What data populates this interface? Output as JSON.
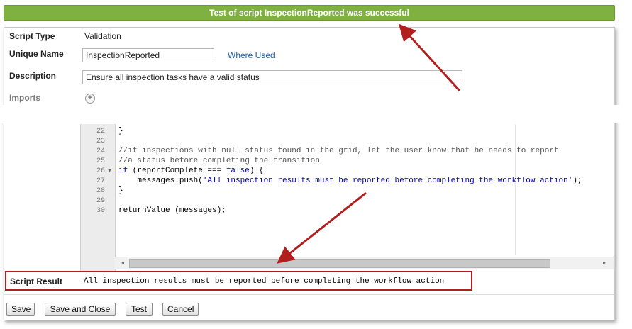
{
  "banner": {
    "message": "Test of script InspectionReported was successful"
  },
  "form": {
    "script_type_label": "Script Type",
    "script_type_value": "Validation",
    "unique_name_label": "Unique Name",
    "unique_name_value": "InspectionReported",
    "where_used_link": "Where Used",
    "description_label": "Description",
    "description_value": "Ensure all inspection tasks have a valid status",
    "imports_label": "Imports",
    "add_import_icon": "plus-circle-icon"
  },
  "editor": {
    "line_numbers": [
      "22",
      "23",
      "24",
      "25",
      "26",
      "27",
      "28",
      "29",
      "30"
    ],
    "lines": {
      "l22": "}",
      "l24": "//if inspections with null status found in the grid, let the user know that he needs to report",
      "l25": "//a status before completing the transition",
      "l26_kw": "if",
      "l26_kw2": "false",
      "l26_a": " (reportComplete === ",
      "l26_b": ") {",
      "l27_a": "    messages.push(",
      "l27_str": "'All inspection results must be reported before completing the workflow action'",
      "l27_b": ");",
      "l28": "}",
      "l30": "returnValue (messages);"
    },
    "scroll_left_icon": "◂",
    "scroll_right_icon": "▸"
  },
  "result": {
    "label": "Script Result",
    "value": "All inspection results must be reported before completing the workflow action"
  },
  "buttons": {
    "save": "Save",
    "save_close": "Save and Close",
    "test": "Test",
    "cancel": "Cancel"
  },
  "colors": {
    "banner_bg": "#7fb140",
    "annotation_red": "#b01e1e",
    "link_blue": "#1f5fa8"
  }
}
